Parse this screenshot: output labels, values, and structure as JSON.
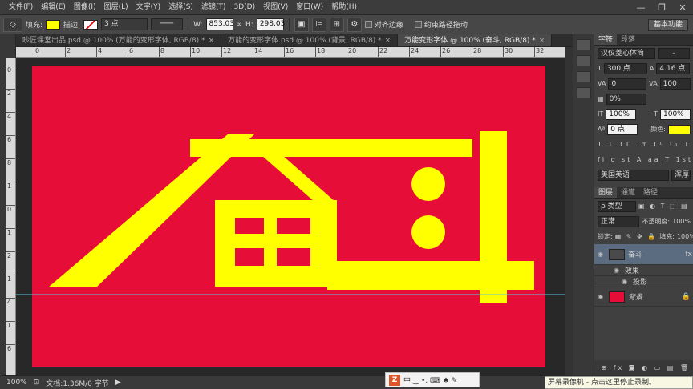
{
  "menu": [
    "文件(F)",
    "编辑(E)",
    "图像(I)",
    "图层(L)",
    "文字(Y)",
    "选择(S)",
    "滤镜(T)",
    "3D(D)",
    "视图(V)",
    "窗口(W)",
    "帮助(H)"
  ],
  "options": {
    "fill_label": "填充:",
    "stroke_label": "描边:",
    "stroke_width": "3 点",
    "w_label": "W:",
    "w_value": "853.03",
    "h_label": "H:",
    "h_value": "298.03",
    "align_edges": "对齐边缘",
    "constrain": "约束路径拖动",
    "workspace": "基本功能",
    "fill_color": "#ffff00"
  },
  "tabs": [
    {
      "label": "吵匠课堂出品.psd @ 100% (万能的变形字体, RGB/8) *",
      "close": "×"
    },
    {
      "label": "万能的变形字体.psd @ 100% (背景, RGB/8) *",
      "close": "×"
    },
    {
      "label": "万能变形字体 @ 100% (奋斗, RGB/8) *",
      "close": "×"
    }
  ],
  "ruler": {
    "h": [
      "0",
      "2",
      "4",
      "6",
      "8",
      "10",
      "12",
      "14",
      "16",
      "18",
      "20",
      "22",
      "24",
      "26",
      "28",
      "30",
      "32"
    ],
    "v": [
      "0",
      "2",
      "4",
      "6",
      "8",
      "1",
      "0",
      "1",
      "2",
      "1",
      "4",
      "1",
      "6"
    ]
  },
  "canvas": {
    "bg": "#e60e38",
    "text_color": "#ffff00"
  },
  "status": {
    "zoom": "100%",
    "doc": "文档:1.36M/0 字节"
  },
  "ime": {
    "logo": "Z",
    "chars": "中 ‿ •, ⌨ ♠ ✎"
  },
  "rec_note": "屏幕录像机 - 点击这里停止录制。",
  "char_panel": {
    "tabs": [
      "字符",
      "段落"
    ],
    "font": "汉仪菱心体简",
    "font_style": "-",
    "size": "300 点",
    "leading": "4.16 点",
    "tracking_kern": "0",
    "tracking": "100",
    "scale_pct": "0%",
    "v_scale": "100%",
    "h_scale": "100%",
    "baseline": "0 点",
    "color_label": "颜色:",
    "color": "#ffff00",
    "language": "美国英语",
    "aa": "浑厚",
    "glyph_row1": "T T TT Tт T¹ T₁ T T",
    "glyph_row2": "fi ơ st A aa T 1st ½"
  },
  "layers_panel": {
    "tabs": [
      "图层",
      "通道",
      "路径"
    ],
    "filter": "ρ 类型",
    "blend": "正常",
    "opacity_label": "不透明度:",
    "opacity": "100%",
    "lock_label": "锁定:",
    "fill_label": "填充:",
    "fill": "100%",
    "layers": [
      {
        "name": "奋斗",
        "fx": "fx"
      },
      {
        "name": "效果"
      },
      {
        "name": "投影"
      },
      {
        "name": "背景"
      }
    ],
    "bottom_icons": "⊕ fx ◙ ◐ ▭ ▤ 🗑"
  }
}
